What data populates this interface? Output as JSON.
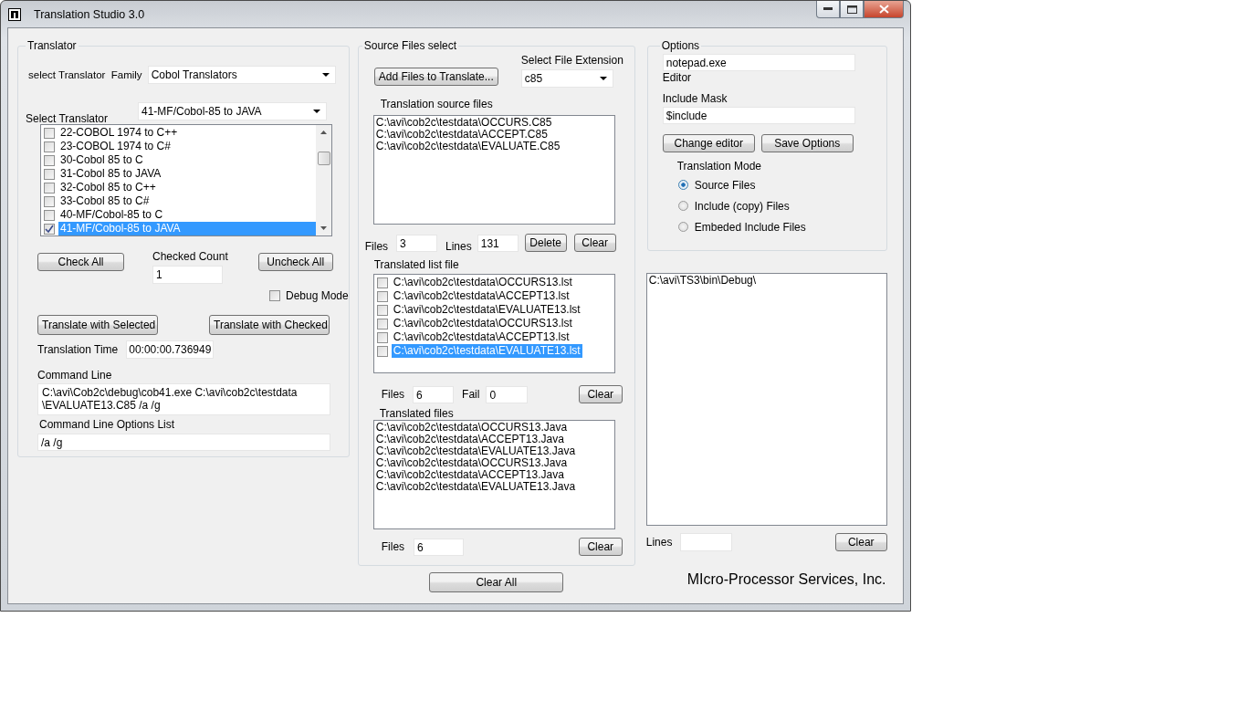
{
  "window": {
    "title": "Translation Studio 3.0"
  },
  "translator": {
    "title": "Translator",
    "family_label": "select Translator  Family",
    "family": "Cobol Translators",
    "translator_label": "Select Translator",
    "translator": "41-MF/Cobol-85 to JAVA",
    "items": [
      {
        "label": "22-COBOL 1974 to C++",
        "checked": false,
        "selected": false
      },
      {
        "label": "23-COBOL 1974 to C#",
        "checked": false,
        "selected": false
      },
      {
        "label": "30-Cobol 85 to C",
        "checked": false,
        "selected": false
      },
      {
        "label": "31-Cobol 85 to JAVA",
        "checked": false,
        "selected": false
      },
      {
        "label": "32-Cobol 85 to C++",
        "checked": false,
        "selected": false
      },
      {
        "label": "33-Cobol 85 to C#",
        "checked": false,
        "selected": false
      },
      {
        "label": "40-MF/Cobol-85 to C",
        "checked": false,
        "selected": false
      },
      {
        "label": "41-MF/Cobol-85 to JAVA",
        "checked": true,
        "selected": true
      }
    ],
    "check_all": "Check All",
    "checked_count_label": "Checked Count",
    "checked_count": "1",
    "uncheck_all": "Uncheck All",
    "debug_mode": {
      "label": "Debug Mode",
      "checked": false
    },
    "translate_selected": "Translate  with  Selected",
    "translate_checked": "Translate with Checked",
    "time_label": "Translation Time",
    "time": "00:00:00.736949",
    "command_line_label": "Command Line",
    "command_line": "C:\\avi\\Cob2c\\debug\\cob41.exe C:\\avi\\cob2c\\testdata \\EVALUATE13.C85 /a /g",
    "options_list_label": "Command Line Options List",
    "options_list": "/a /g"
  },
  "source": {
    "title": "Source Files select",
    "add_button": "Add Files to Translate...",
    "ext_label": "Select File Extension",
    "ext": "c85",
    "source_label": "Translation source files",
    "source_files": [
      "C:\\avi\\cob2c\\testdata\\OCCURS.C85",
      "C:\\avi\\cob2c\\testdata\\ACCEPT.C85",
      "C:\\avi\\cob2c\\testdata\\EVALUATE.C85"
    ],
    "files_label": "Files",
    "files": "3",
    "lines_label": "Lines",
    "lines": "131",
    "delete": "Delete",
    "clear": "Clear",
    "list_label": "Translated list file",
    "list_files": [
      {
        "path": "C:\\avi\\cob2c\\testdata\\OCCURS13.lst",
        "checked": false,
        "selected": false
      },
      {
        "path": "C:\\avi\\cob2c\\testdata\\ACCEPT13.lst",
        "checked": false,
        "selected": false
      },
      {
        "path": "C:\\avi\\cob2c\\testdata\\EVALUATE13.lst",
        "checked": false,
        "selected": false
      },
      {
        "path": "C:\\avi\\cob2c\\testdata\\OCCURS13.lst",
        "checked": false,
        "selected": false
      },
      {
        "path": "C:\\avi\\cob2c\\testdata\\ACCEPT13.lst",
        "checked": false,
        "selected": false
      },
      {
        "path": "C:\\avi\\cob2c\\testdata\\EVALUATE13.lst",
        "checked": false,
        "selected": true
      }
    ],
    "list_files_label": "Files",
    "list_count": "6",
    "fail_label": "Fail",
    "fail": "0",
    "list_clear": "Clear",
    "translated_label": "Translated files",
    "translated": [
      "C:\\avi\\cob2c\\testdata\\OCCURS13.Java",
      "C:\\avi\\cob2c\\testdata\\ACCEPT13.Java",
      "C:\\avi\\cob2c\\testdata\\EVALUATE13.Java",
      "C:\\avi\\cob2c\\testdata\\OCCURS13.Java",
      "C:\\avi\\cob2c\\testdata\\ACCEPT13.Java",
      "C:\\avi\\cob2c\\testdata\\EVALUATE13.Java"
    ],
    "translated_files_label": "Files",
    "translated_count": "6",
    "translated_clear": "Clear"
  },
  "clear_all": "Clear All",
  "options": {
    "title": "Options",
    "editor": "notepad.exe",
    "editor_label": "Editor",
    "mask_label": "Include Mask",
    "mask": "$include",
    "change_editor": "Change editor",
    "save_options": "Save Options",
    "mode_label": "Translation Mode",
    "modes": [
      {
        "label": "Source Files",
        "selected": true
      },
      {
        "label": "Include (copy) Files",
        "selected": false
      },
      {
        "label": "Embeded Include Files",
        "selected": false
      }
    ]
  },
  "output": {
    "lines": [
      "C:\\avi\\TS3\\bin\\Debug\\"
    ],
    "lines_label": "Lines",
    "clear": "Clear"
  },
  "company": "MIcro-Processor Services, Inc."
}
